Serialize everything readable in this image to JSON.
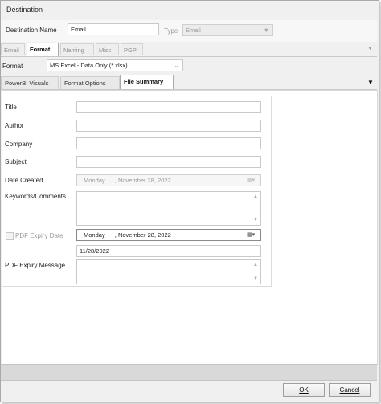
{
  "window": {
    "title": "Destination"
  },
  "header": {
    "destination_name_label": "Destination Name",
    "destination_name_value": "Email",
    "type_label": "Type",
    "type_value": "Email"
  },
  "top_tabs": [
    {
      "label": "Email",
      "active": false
    },
    {
      "label": "Format",
      "active": true
    },
    {
      "label": "Naming",
      "active": false
    },
    {
      "label": "Misc",
      "active": false
    },
    {
      "label": "PGP",
      "active": false
    }
  ],
  "format": {
    "label": "Format",
    "value": "MS Excel - Data Only (*.xlsx)"
  },
  "sub_tabs": [
    {
      "label": "PowerBI Visuals",
      "active": false
    },
    {
      "label": "Format Options",
      "active": false
    },
    {
      "label": "File Summary",
      "active": true
    }
  ],
  "summary": {
    "title_label": "Title",
    "title_value": "",
    "author_label": "Author",
    "author_value": "",
    "company_label": "Company",
    "company_value": "",
    "subject_label": "Subject",
    "subject_value": "",
    "date_created_label": "Date Created",
    "date_created_day": "Monday",
    "date_created_date": ", November  28, 2022",
    "keywords_label": "Keywords/Comments",
    "keywords_value": "",
    "pdf_expiry_date_label": "PDF Expiry Date",
    "pdf_expiry_date_checked": false,
    "pdf_expiry_day": "Monday",
    "pdf_expiry_date": ", November  28, 2022",
    "pdf_expiry_short": "11/28/2022",
    "pdf_expiry_message_label": "PDF Expiry Message",
    "pdf_expiry_message_value": ""
  },
  "buttons": {
    "ok": "OK",
    "cancel": "Cancel"
  },
  "icons": {
    "dropdown": "chevron-down-icon",
    "calendar": "calendar-icon",
    "overflow": "triangle-down-icon"
  }
}
